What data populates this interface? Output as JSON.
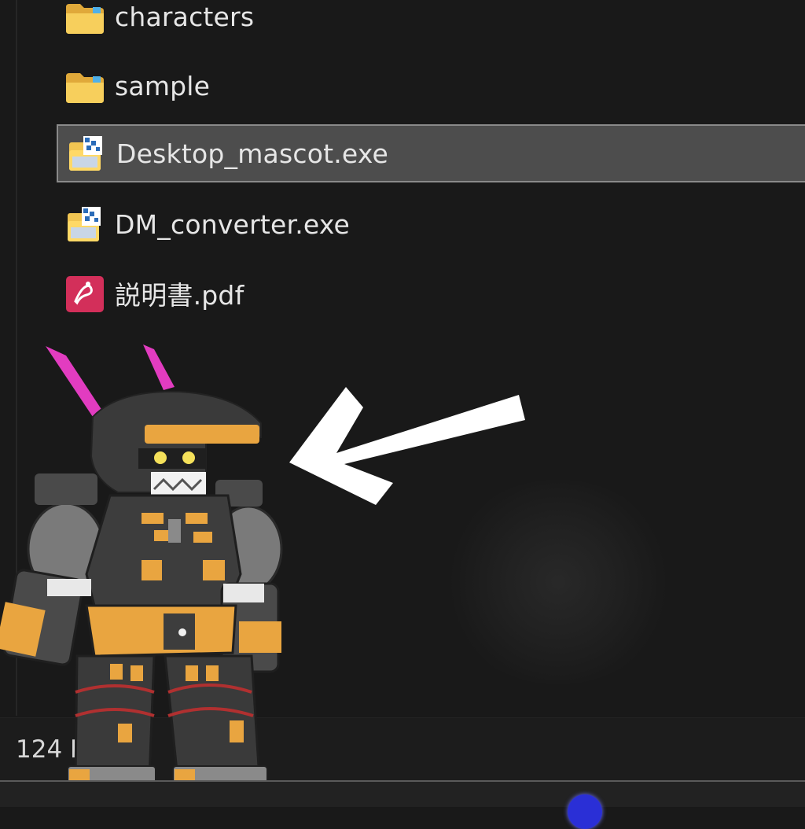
{
  "explorer": {
    "files": [
      {
        "name": "characters",
        "icon": "folder-icon",
        "selected": false
      },
      {
        "name": "sample",
        "icon": "folder-icon",
        "selected": false
      },
      {
        "name": "Desktop_mascot.exe",
        "icon": "app-exe-icon",
        "selected": true
      },
      {
        "name": "DM_converter.exe",
        "icon": "app-exe-icon",
        "selected": false
      },
      {
        "name": "説明書.pdf",
        "icon": "pdf-icon",
        "selected": false
      }
    ],
    "status": {
      "item_count": "124 I"
    }
  },
  "colors": {
    "background": "#191919",
    "selection": "#4d4d4d",
    "folder": "#f2c14e",
    "pdf": "#d32f5a",
    "arrow": "#ffffff",
    "mascot_accent": "#e9a540",
    "mascot_ears": "#e23cc0"
  },
  "overlay": {
    "arrow_icon": "arrow-pointing-left-icon",
    "mascot": "robot-mascot-character"
  }
}
